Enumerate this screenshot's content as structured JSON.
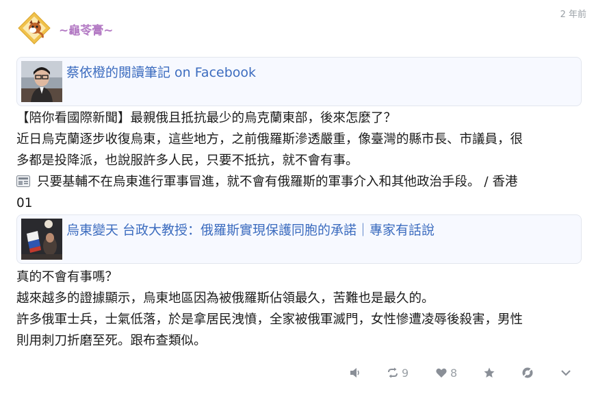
{
  "post": {
    "author_name": "~龜苓膏~",
    "timestamp": "2 年前",
    "card_1": {
      "title": "蔡依橙的閱讀筆記 on Facebook"
    },
    "body_1": {
      "line_1": "【陪你看國際新聞】最親俄且抵抗最少的烏克蘭東部，後來怎麼了？",
      "line_2": "近日烏克蘭逐步收復烏東，這些地方，之前俄羅斯滲透嚴重，像臺灣的縣市長、市議員，很",
      "line_3": "多都是投降派，也說服許多人民，只要不抵抗，就不會有事。",
      "line_4": "只要基輔不在烏東進行軍事冒進，就不會有俄羅斯的軍事介入和其他政治手段。 / 香港",
      "line_5": "01"
    },
    "card_2": {
      "title": "烏東變天 台政大教授：俄羅斯實現保護同胞的承諾｜專家有話說"
    },
    "body_2": {
      "line_1": "真的不會有事嗎？",
      "line_2": "越來越多的證據顯示，烏東地區因為被俄羅斯佔領最久，苦難也是最久的。",
      "line_3": "許多俄軍士兵，士氣低落，於是拿居民洩憤，全家被俄軍滅門，女性慘遭凌辱後殺害，男性",
      "line_4": "則用刺刀折磨至死。跟布查類似。"
    },
    "actions": {
      "boost_count": "9",
      "like_count": "8"
    }
  },
  "colors": {
    "author_name": "#b37ac4",
    "link": "#3c6cbf",
    "card_background": "#f7f9ff",
    "action_icon": "#8a8f97"
  },
  "icons": [
    "avatar-icon",
    "news-icon",
    "speak-icon",
    "boost-icon",
    "heart-icon",
    "star-icon",
    "hide-icon",
    "chevron-down-icon"
  ]
}
